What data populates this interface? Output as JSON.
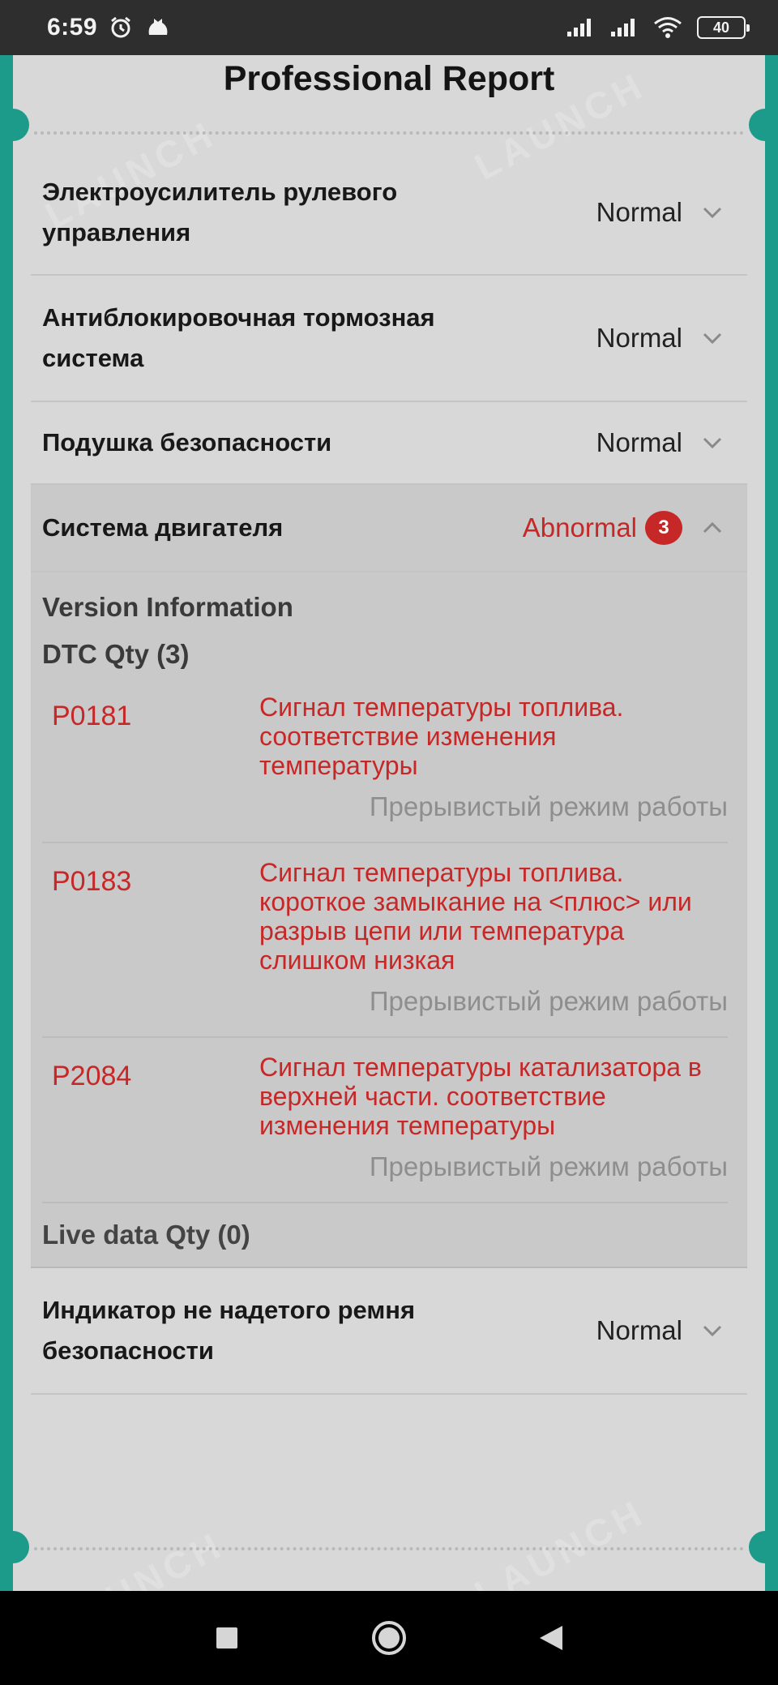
{
  "status_bar": {
    "time": "6:59",
    "battery": "40",
    "icons": [
      "alarm-icon",
      "notification-icon",
      "signal-icon",
      "signal-icon",
      "wifi-icon",
      "battery-icon"
    ]
  },
  "report": {
    "title": "Professional Report",
    "colors": {
      "accent": "#1c9a8a",
      "abnormal": "#c62828"
    },
    "systems": [
      {
        "name": "Электроусилитель рулевого управления",
        "status": "Normal"
      },
      {
        "name": "Антиблокировочная тормозная система",
        "status": "Normal"
      },
      {
        "name": "Подушка безопасности",
        "status": "Normal"
      },
      {
        "name": "Система двигателя",
        "status": "Abnormal",
        "count": "3"
      },
      {
        "name": "Индикатор не надетого ремня безопасности",
        "status": "Normal"
      }
    ],
    "engine_detail": {
      "version_info": "Version Information",
      "dtc_qty": "DTC Qty (3)",
      "dtcs": [
        {
          "code": "P0181",
          "description": "Сигнал температуры топлива. соответствие изменения температуры",
          "state": "Прерывистый режим работы"
        },
        {
          "code": "P0183",
          "description": "Сигнал температуры топлива. короткое замыкание на <плюс> или разрыв цепи или температура слишком низкая",
          "state": "Прерывистый режим работы"
        },
        {
          "code": "P2084",
          "description": "Сигнал температуры катализатора в верхней части. соответствие изменения температуры",
          "state": "Прерывистый режим работы"
        }
      ],
      "live_data_qty": "Live data Qty (0)"
    }
  },
  "nav": {
    "icons": [
      "recents-icon",
      "home-icon",
      "back-icon"
    ]
  }
}
